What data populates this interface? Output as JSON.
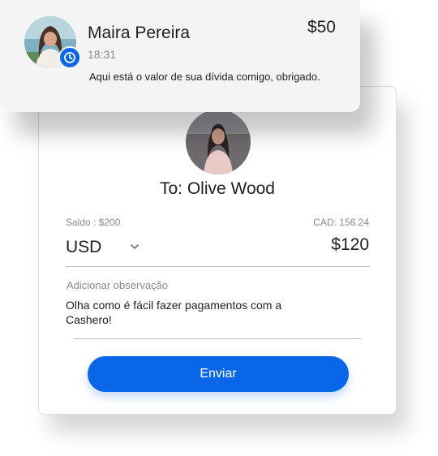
{
  "notification": {
    "sender_name": "Maira Pereira",
    "time": "18:31",
    "amount": "$50",
    "message": "Aqui está o valor de sua dívida comigo, obrigado.",
    "badge_icon": "clock-icon"
  },
  "payment": {
    "recipient": "To: Olive Wood",
    "balance": "Saldo : $200",
    "converted": "CAD: 156.24",
    "currency": "USD",
    "amount": "$120",
    "note_label": "Adicionar observação",
    "note_text": "Olha como é fácil fazer pagamentos com a Cashero!",
    "send_label": "Enviar"
  },
  "colors": {
    "accent": "#0a66e8",
    "text": "#1f1f1f",
    "muted": "#8a8a8a",
    "notification_bg": "#f4f4f4"
  }
}
